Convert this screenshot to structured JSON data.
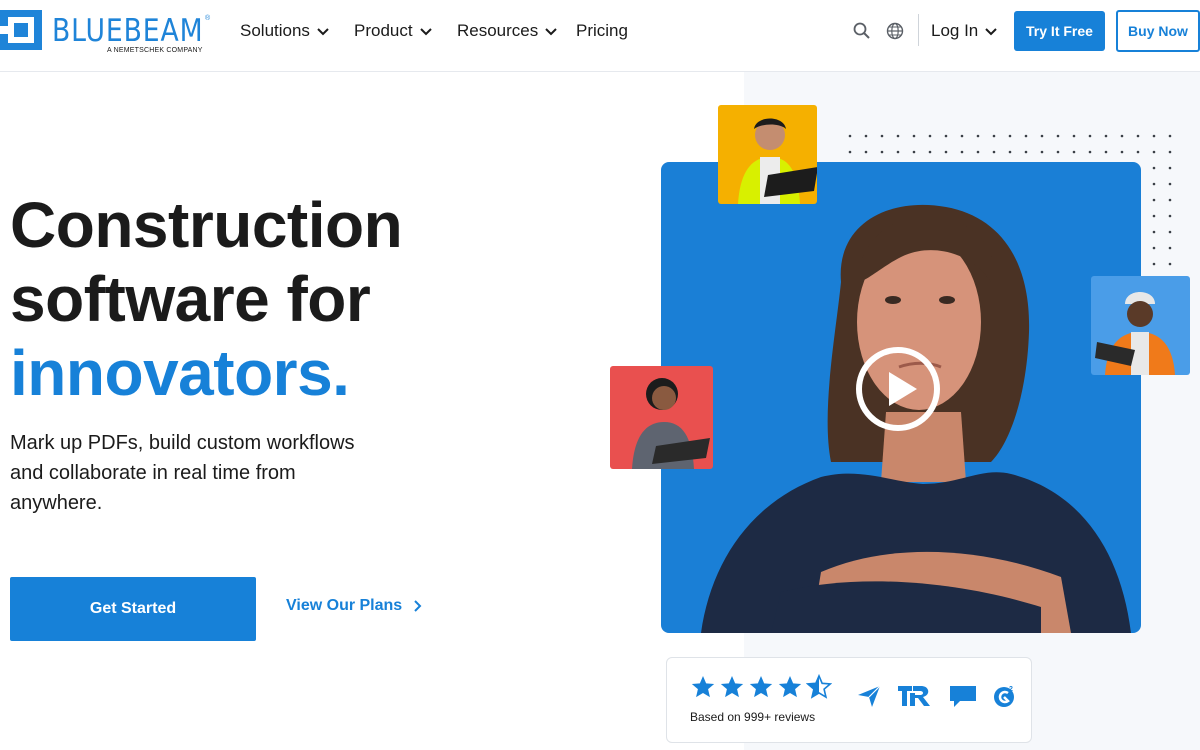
{
  "brand": {
    "name": "BLUEBEAM",
    "tagline": "A NEMETSCHEK COMPANY",
    "registered": "®",
    "color": "#1f84d8"
  },
  "nav": {
    "items": [
      {
        "label": "Solutions",
        "has_dropdown": true
      },
      {
        "label": "Product",
        "has_dropdown": true
      },
      {
        "label": "Resources",
        "has_dropdown": true
      },
      {
        "label": "Pricing",
        "has_dropdown": false
      }
    ],
    "search_icon": "search-icon",
    "language_icon": "globe-icon",
    "login_label": "Log In",
    "try_label": "Try It Free",
    "buy_label": "Buy Now"
  },
  "hero": {
    "headline_line1": "Construction",
    "headline_line2": "software for",
    "headline_accent": "innovators.",
    "subtext": "Mark up PDFs, build custom workflows and collaborate in real time from anywhere.",
    "primary_cta": "Get Started",
    "secondary_cta": "View Our Plans"
  },
  "media": {
    "play_icon": "play-icon",
    "accent_color": "#1a7fd6"
  },
  "rating": {
    "stars": 4.5,
    "max_stars": 5,
    "reviews_text": "Based on 999+ reviews",
    "badge_icons": [
      "capterra-icon",
      "trustradius-icon",
      "software-advice-icon",
      "g2-icon"
    ]
  },
  "colors": {
    "primary": "#1781d8",
    "text": "#1b1b1b"
  }
}
